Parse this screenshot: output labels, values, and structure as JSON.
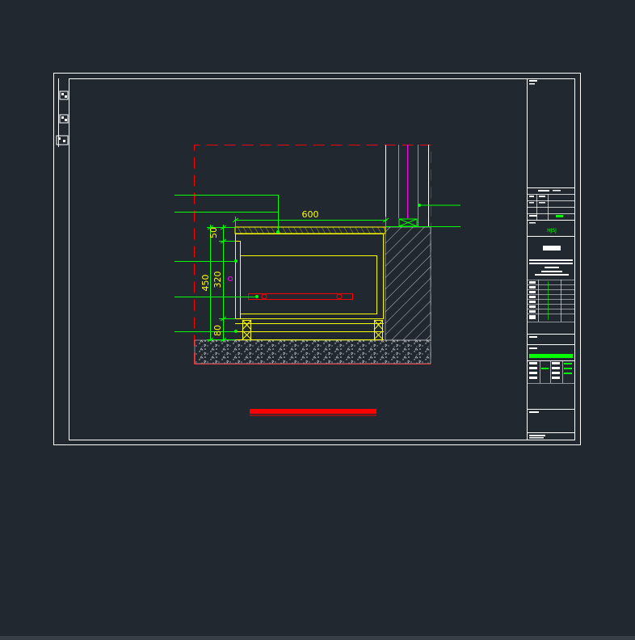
{
  "drawing": {
    "dimensions": {
      "width_total": "600",
      "height_total": "450",
      "height_middle": "320",
      "height_top": "50",
      "height_bottom": "80"
    },
    "title_block": {
      "company_code": "HJSJ"
    }
  },
  "colors": {
    "background": "#212830",
    "frame": "#ffffff",
    "dimension": "#00ff00",
    "cabinet": "#ffff00",
    "boundary": "#ff0000",
    "accent": "#ff00ff",
    "hatch": "#c8c8c8"
  }
}
